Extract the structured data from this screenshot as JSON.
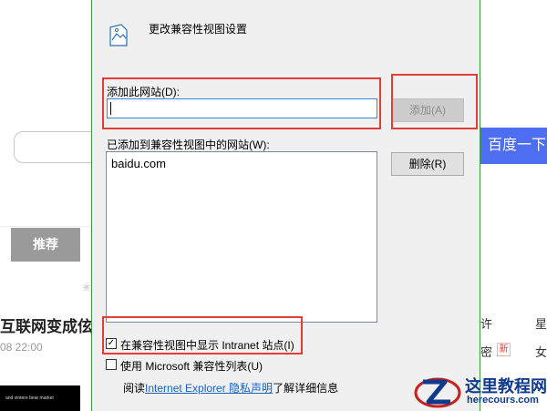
{
  "background_page": {
    "baidu_button_label": "百度一下",
    "recommend_tab_label": "推荐",
    "headline_fragment": "互联网变成伭",
    "time_fragment": "08 22:00",
    "thumbnail_text": "and vintere bear market",
    "side_chars": [
      "许",
      "星",
      "密",
      "女"
    ],
    "new_tag": "新"
  },
  "dialog": {
    "title": "更改兼容性视图设置",
    "add_site_label": "添加此网站(D):",
    "add_site_value": "",
    "add_button_label": "添加(A)",
    "added_sites_label": "已添加到兼容性视图中的网站(W):",
    "added_sites": [
      "baidu.com"
    ],
    "remove_button_label": "删除(R)",
    "checkbox_intranet": {
      "label": "在兼容性视图中显示 Intranet 站点(I)",
      "checked": true
    },
    "checkbox_ms_list": {
      "label": "使用 Microsoft 兼容性列表(U)",
      "checked": false
    },
    "read_prefix": "阅读",
    "privacy_link": "Internet Explorer 隐私声明",
    "read_suffix": "了解详细信息"
  },
  "watermark": {
    "title": "这里教程网",
    "subtitle": "herecours.com"
  }
}
